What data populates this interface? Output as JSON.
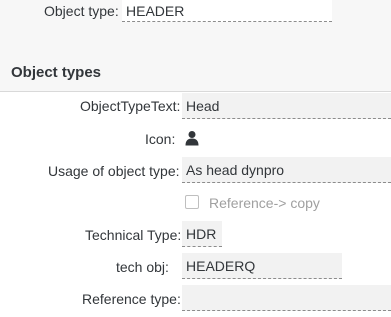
{
  "header": {
    "object_type_label": "Object type:",
    "object_type_value": "HEADER"
  },
  "section": {
    "title": "Object types"
  },
  "form": {
    "object_type_text_label": "ObjectTypeText:",
    "object_type_text_value": "Head",
    "icon_label": "Icon:",
    "icon_name": "person-icon",
    "usage_label": "Usage of object type:",
    "usage_value": "As head dynpro",
    "reference_copy_label": "Reference-> copy",
    "reference_copy_checked": false,
    "technical_type_label": "Technical Type:",
    "technical_type_value": "HDR",
    "tech_obj_label": "tech obj:",
    "tech_obj_value": "HEADERQ",
    "reference_type_label": "Reference type:",
    "reference_type_value": ""
  },
  "colors": {
    "field_bg": "#f2f2f2",
    "text": "#32363a",
    "disabled_text": "#a0a0a0"
  }
}
